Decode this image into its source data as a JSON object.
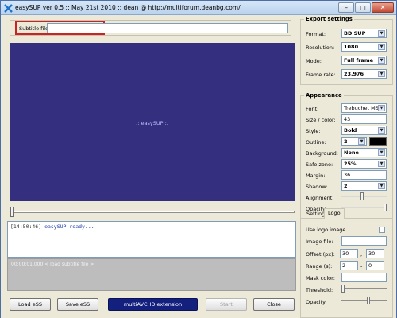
{
  "window": {
    "title": "easySUP ver 0.5 :: May 21st 2010 :: dean @ http://multiforum.deanbg.com/",
    "controls": {
      "minimize": "–",
      "maximize": "□",
      "close": "✕"
    }
  },
  "subtitle": {
    "label": "Subtitle file:",
    "value": ""
  },
  "preview": {
    "text": ".: easySUP :."
  },
  "log": {
    "time": "[14:50:46]",
    "message": "easySUP ready..."
  },
  "progress": {
    "text": "00:00:01.000 < load subtitle file >"
  },
  "buttons": {
    "load": "Load eSS",
    "save": "Save eSS",
    "extension": "multiAVCHD extension",
    "start": "Start",
    "close": "Close"
  },
  "export": {
    "title": "Export settings",
    "rows": [
      {
        "label": "Format:",
        "value": "BD SUP"
      },
      {
        "label": "Resolution:",
        "value": "1080"
      },
      {
        "label": "Mode:",
        "value": "Full frame"
      },
      {
        "label": "Frame rate:",
        "value": "23.976"
      }
    ]
  },
  "appearance": {
    "title": "Appearance",
    "font_label": "Font:",
    "font_value": "Trebuchet MS",
    "size_label": "Size / color:",
    "size_value": "43",
    "style_label": "Style:",
    "style_value": "Bold",
    "outline_label": "Outline:",
    "outline_value": "2",
    "background_label": "Background:",
    "background_value": "None",
    "safezone_label": "Safe zone:",
    "safezone_value": "25%",
    "margin_label": "Margin:",
    "margin_value": "36",
    "shadow_label": "Shadow:",
    "shadow_value": "2",
    "alignment_label": "Alignment:",
    "alignment_level": 0.45,
    "opacity_label": "Opacity:",
    "opacity_level": 1.0
  },
  "tabs": {
    "settings": "Settings",
    "logo": "Logo"
  },
  "logo": {
    "use_label": "Use logo image",
    "image_label": "Image file:",
    "offset_label": "Offset (px):",
    "offset_x": "30",
    "offset_y": "30",
    "range_label": "Range (s):",
    "range_from": "2",
    "range_to": "0",
    "mask_label": "Mask color:",
    "threshold_label": "Threshold:",
    "threshold_level": 0.0,
    "opacity_label": "Opacity:",
    "opacity_level": 0.6,
    "comma": ",",
    "dash": "-"
  },
  "colors": {
    "preview_bg": "#352f7f",
    "highlight": "#cc2222",
    "extension_button": "#14207e",
    "outline_color": "#000000"
  }
}
